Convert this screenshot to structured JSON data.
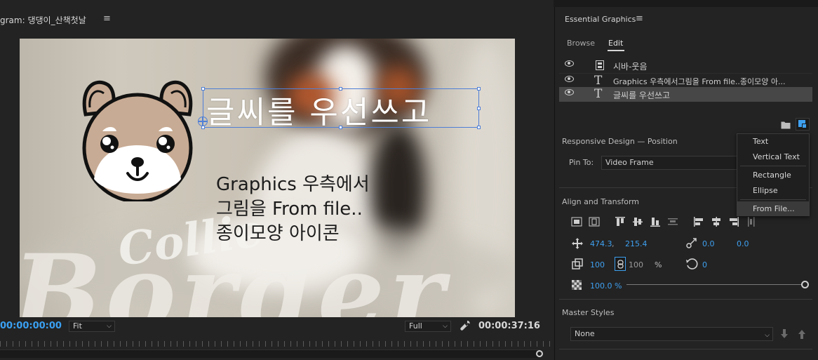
{
  "program": {
    "title": "gram: 댕댕이_산책첫날",
    "timecode_current": "00:00:00:00",
    "timecode_total": "00:00:37:16",
    "zoom_select": "Fit",
    "resolution_select": "Full"
  },
  "video": {
    "title_text": "글씨를 우선쓰고",
    "body_lines": [
      "Graphics 우측에서",
      "그림을 From file..",
      "종이모양 아이콘"
    ],
    "watermark_small": "Collie",
    "watermark_large": "Border"
  },
  "eg": {
    "title": "Essential Graphics",
    "tabs": [
      "Browse",
      "Edit"
    ],
    "active_tab": "Edit",
    "layers": [
      {
        "icon": "film-icon",
        "label": "시바-웃음"
      },
      {
        "icon": "text-icon",
        "label": "Graphics 우측에서그림을 From file..종이모양 아..."
      },
      {
        "icon": "text-icon",
        "label": "글씨를 우선쓰고"
      }
    ],
    "responsive_design": {
      "title": "Responsive Design — Position",
      "pin_to_label": "Pin To:",
      "pin_to_value": "Video Frame"
    },
    "align_transform": {
      "title": "Align and Transform",
      "position_x": "474.3",
      "position_sep": ",",
      "position_y": "215.4",
      "anchor_x": "0.0",
      "anchor_y": "0.0",
      "scale": "100",
      "scale_locked": "100",
      "scale_unit": "%",
      "rotation": "0",
      "opacity": "100.0 %"
    },
    "master_styles": {
      "title": "Master Styles",
      "value": "None"
    },
    "new_layer_menu": [
      "Text",
      "Vertical Text",
      "Rectangle",
      "Ellipse",
      "From File..."
    ]
  },
  "colors": {
    "accent": "#3ea0f0",
    "selection": "#4f7fd6"
  }
}
